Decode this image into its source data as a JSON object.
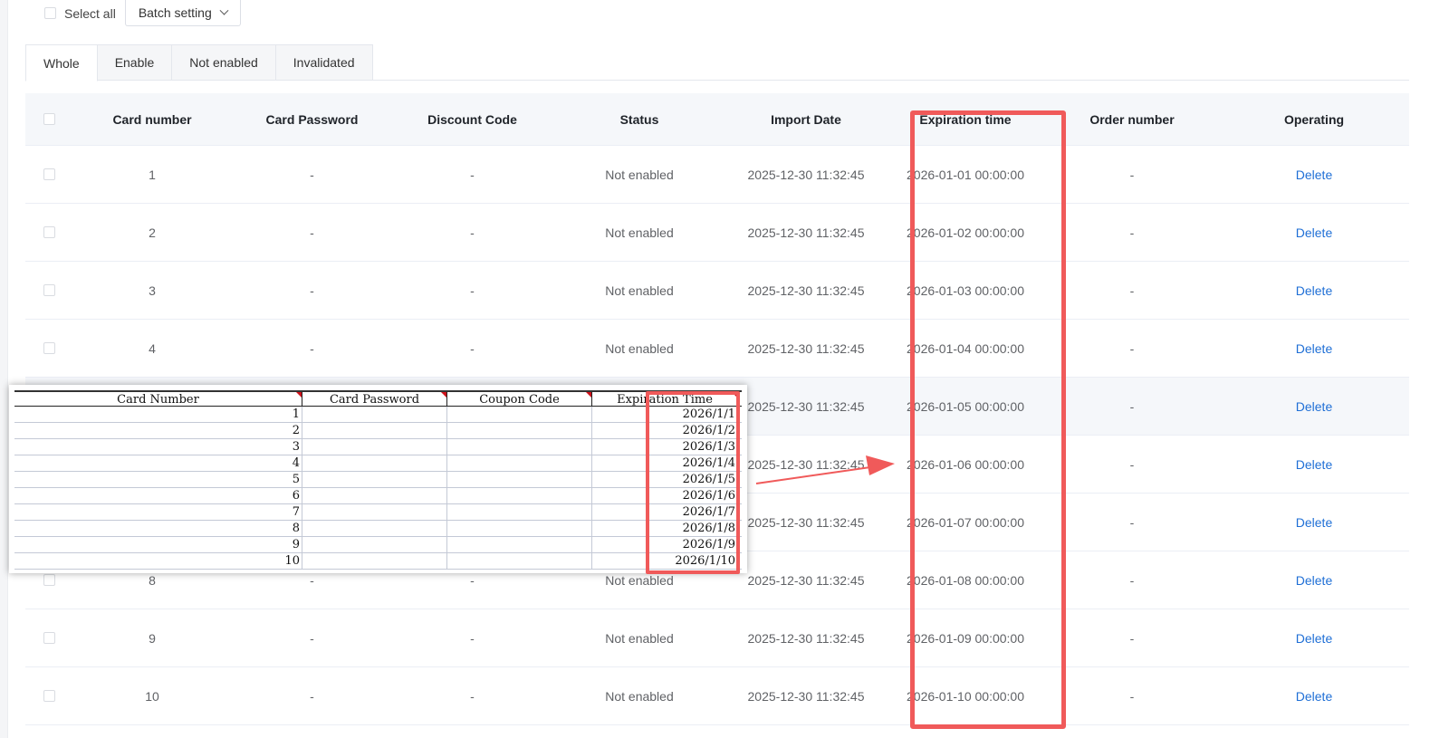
{
  "toolbar": {
    "select_all_label": "Select all",
    "batch_label": "Batch setting",
    "batch_icon": "chevron-down-icon"
  },
  "tabs": [
    {
      "label": "Whole",
      "active": true
    },
    {
      "label": "Enable"
    },
    {
      "label": "Not enabled"
    },
    {
      "label": "Invalidated"
    }
  ],
  "table": {
    "headers": [
      "Card number",
      "Card Password",
      "Discount Code",
      "Status",
      "Import Date",
      "Expiration time",
      "Order number",
      "Operating"
    ],
    "rows": [
      {
        "card": "1",
        "pwd": "-",
        "code": "-",
        "status": "Not enabled",
        "import": "2025-12-30 11:32:45",
        "exp": "2026-01-01 00:00:00",
        "order": "-",
        "op": "Delete"
      },
      {
        "card": "2",
        "pwd": "-",
        "code": "-",
        "status": "Not enabled",
        "import": "2025-12-30 11:32:45",
        "exp": "2026-01-02 00:00:00",
        "order": "-",
        "op": "Delete"
      },
      {
        "card": "3",
        "pwd": "-",
        "code": "-",
        "status": "Not enabled",
        "import": "2025-12-30 11:32:45",
        "exp": "2026-01-03 00:00:00",
        "order": "-",
        "op": "Delete"
      },
      {
        "card": "4",
        "pwd": "-",
        "code": "-",
        "status": "Not enabled",
        "import": "2025-12-30 11:32:45",
        "exp": "2026-01-04 00:00:00",
        "order": "-",
        "op": "Delete"
      },
      {
        "card": "",
        "pwd": "",
        "code": "",
        "status": "",
        "import": "2025-12-30 11:32:45",
        "exp": "2026-01-05 00:00:00",
        "order": "-",
        "op": "Delete"
      },
      {
        "card": "",
        "pwd": "",
        "code": "",
        "status": "",
        "import": "2025-12-30 11:32:45",
        "exp": "2026-01-06 00:00:00",
        "order": "-",
        "op": "Delete"
      },
      {
        "card": "",
        "pwd": "",
        "code": "",
        "status": "",
        "import": "2025-12-30 11:32:45",
        "exp": "2026-01-07 00:00:00",
        "order": "-",
        "op": "Delete"
      },
      {
        "card": "8",
        "pwd": "-",
        "code": "-",
        "status": "Not enabled",
        "import": "2025-12-30 11:32:45",
        "exp": "2026-01-08 00:00:00",
        "order": "-",
        "op": "Delete"
      },
      {
        "card": "9",
        "pwd": "-",
        "code": "-",
        "status": "Not enabled",
        "import": "2025-12-30 11:32:45",
        "exp": "2026-01-09 00:00:00",
        "order": "-",
        "op": "Delete"
      },
      {
        "card": "10",
        "pwd": "-",
        "code": "-",
        "status": "Not enabled",
        "import": "2025-12-30 11:32:45",
        "exp": "2026-01-10 00:00:00",
        "order": "-",
        "op": "Delete"
      }
    ]
  },
  "spreadsheet": {
    "headers": [
      "Card Number",
      "Card Password",
      "Coupon Code",
      "Expiration Time"
    ],
    "rows": [
      [
        "1",
        "",
        "",
        "2026/1/1"
      ],
      [
        "2",
        "",
        "",
        "2026/1/2"
      ],
      [
        "3",
        "",
        "",
        "2026/1/3"
      ],
      [
        "4",
        "",
        "",
        "2026/1/4"
      ],
      [
        "5",
        "",
        "",
        "2026/1/5"
      ],
      [
        "6",
        "",
        "",
        "2026/1/6"
      ],
      [
        "7",
        "",
        "",
        "2026/1/7"
      ],
      [
        "8",
        "",
        "",
        "2026/1/8"
      ],
      [
        "9",
        "",
        "",
        "2026/1/9"
      ],
      [
        "10",
        "",
        "",
        "2026/1/10"
      ]
    ]
  },
  "colors": {
    "highlight": "#f05a5a",
    "link": "#1f6fd6",
    "header_bg": "#f5f7fa"
  }
}
